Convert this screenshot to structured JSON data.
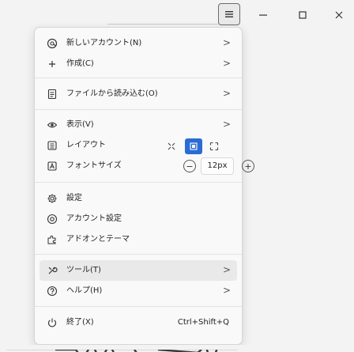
{
  "window": {
    "menu_icon": "kebab-menu-icon",
    "minimize_icon": "minimize-icon",
    "maximize_icon": "maximize-icon",
    "close_icon": "close-icon"
  },
  "menu": {
    "items": [
      {
        "label": "新しいアカウント(N)",
        "icon": "account-add-icon",
        "chevron": ">"
      },
      {
        "label": "作成(C)",
        "icon": "plus-icon",
        "chevron": ">"
      },
      {
        "label": "ファイルから読み込む(O)",
        "icon": "import-file-icon",
        "chevron": ">"
      },
      {
        "label": "表示(V)",
        "icon": "eye-icon",
        "chevron": ">"
      },
      {
        "label": "レイアウト",
        "icon": "layout-icon"
      },
      {
        "label": "フォントサイズ",
        "icon": "font-size-icon"
      },
      {
        "label": "設定",
        "icon": "gear-icon"
      },
      {
        "label": "アカウント設定",
        "icon": "account-settings-icon"
      },
      {
        "label": "アドオンとテーマ",
        "icon": "addons-icon"
      },
      {
        "label": "ツール(T)",
        "icon": "tools-icon",
        "chevron": ">"
      },
      {
        "label": "ヘルプ(H)",
        "icon": "help-icon",
        "chevron": ">"
      },
      {
        "label": "終了(X)",
        "icon": "power-icon",
        "shortcut": "Ctrl+Shift+Q"
      }
    ],
    "font_size": {
      "value": "12px",
      "decrease": "−",
      "increase": "+"
    }
  }
}
